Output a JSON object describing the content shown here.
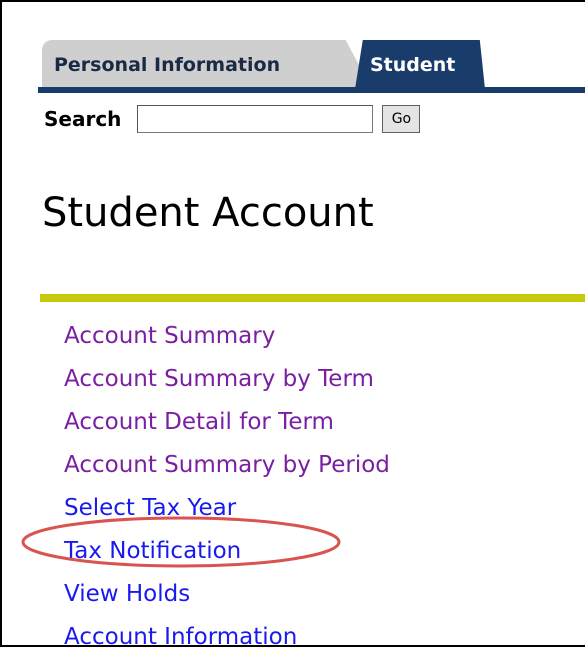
{
  "tabs": [
    {
      "label": "Personal Information",
      "active": false
    },
    {
      "label": "Student",
      "active": true
    }
  ],
  "search": {
    "label": "Search",
    "value": "",
    "placeholder": "",
    "button_label": "Go"
  },
  "page_title": "Student Account",
  "menu": {
    "items": [
      {
        "label": "Account Summary",
        "visited": true
      },
      {
        "label": "Account Summary by Term",
        "visited": true
      },
      {
        "label": "Account Detail for Term",
        "visited": true
      },
      {
        "label": "Account Summary by Period",
        "visited": true
      },
      {
        "label": "Select Tax Year",
        "visited": false
      },
      {
        "label": "Tax Notification",
        "visited": false,
        "highlighted": true
      },
      {
        "label": "View Holds",
        "visited": false
      },
      {
        "label": "Account Information",
        "visited": false
      }
    ]
  },
  "colors": {
    "tab_active_bg": "#1a3c6a",
    "tab_inactive_bg": "#cfcfcf",
    "rule": "#c8c80e",
    "link_visited": "#7a1fa2",
    "link_unvisited": "#1a1aee",
    "highlight_ellipse": "#d9534f"
  }
}
